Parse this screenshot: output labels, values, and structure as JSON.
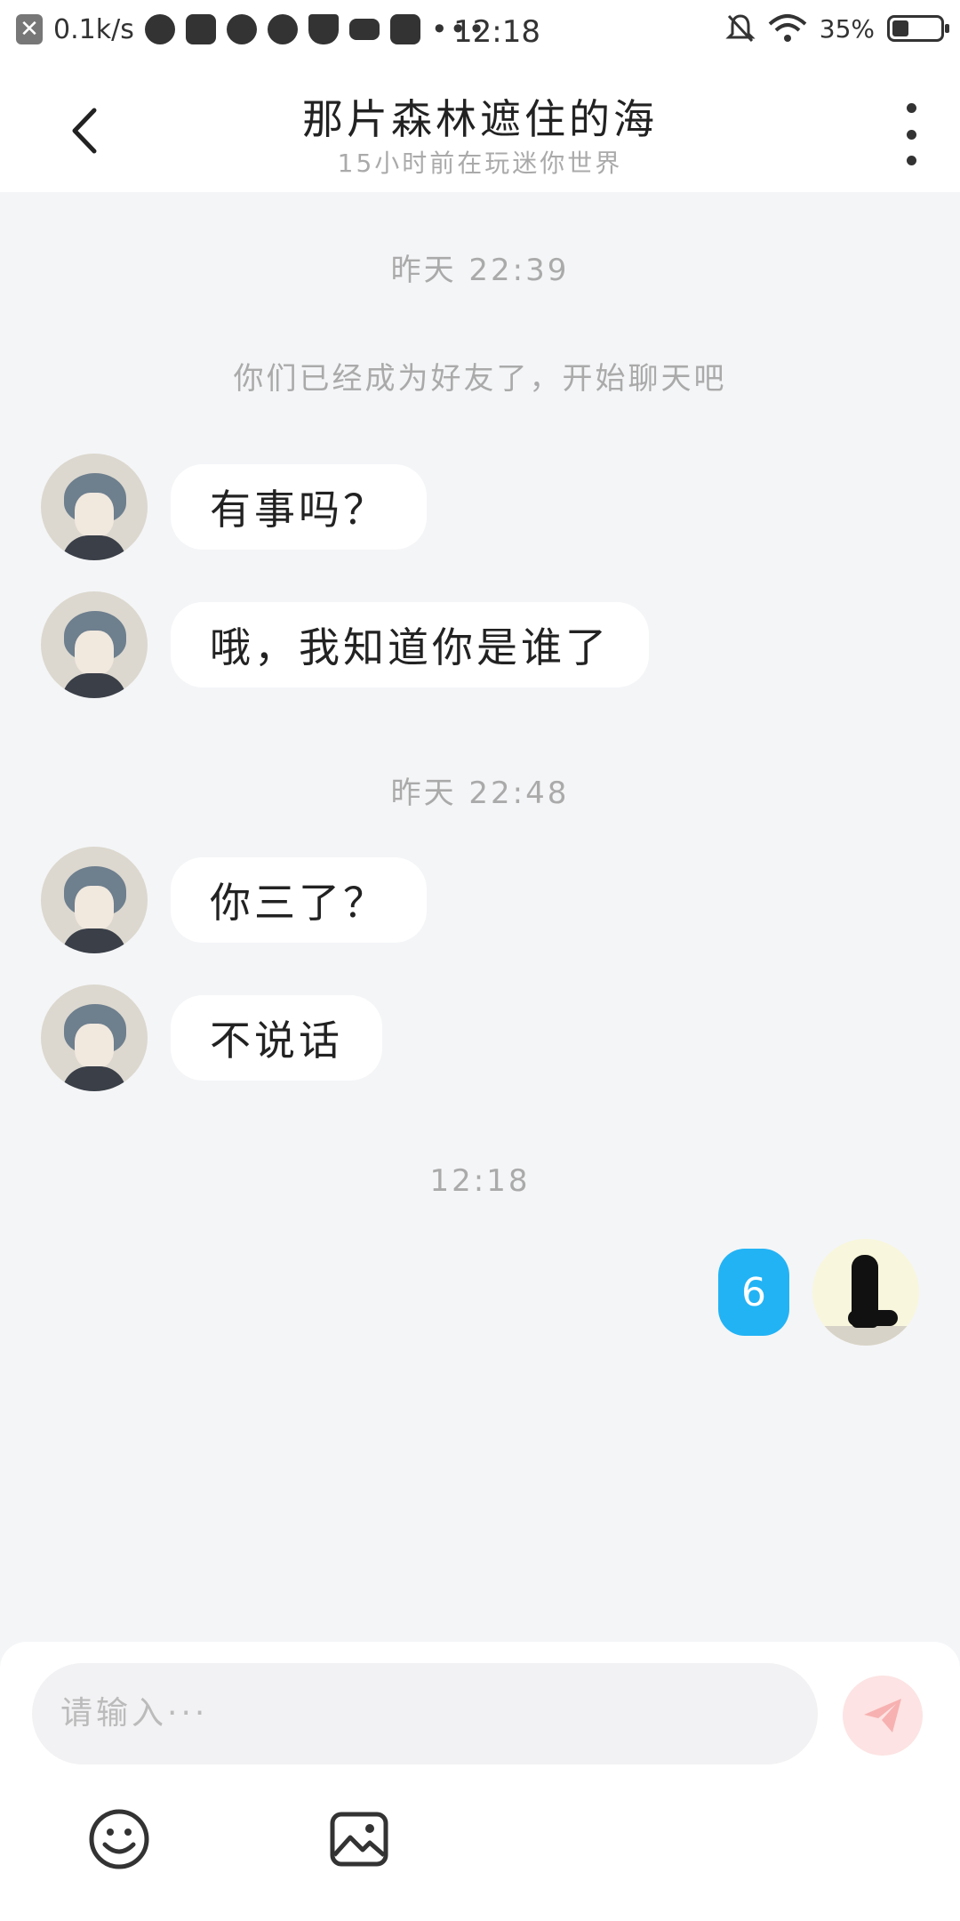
{
  "status_bar": {
    "speed": "0.1k/s",
    "time": "12:18",
    "battery": "35%",
    "battery_level": 0.35,
    "icons": [
      "close-icon",
      "weather-cloud-icon",
      "play-icon",
      "pinwheel-icon",
      "planet-icon",
      "shield-icon",
      "crown-icon",
      "app-icon",
      "more-dots-icon",
      "mute-bell-icon",
      "wifi-icon",
      "battery-icon"
    ]
  },
  "header": {
    "title": "那片森林遮住的海",
    "subtitle": "15小时前在玩迷你世界",
    "back_icon": "chevron-left-icon",
    "more_icon": "more-vertical-icon"
  },
  "chat": {
    "timestamps": [
      "昨天 22:39",
      "昨天 22:48",
      "12:18"
    ],
    "system_message": "你们已经成为好友了，开始聊天吧",
    "messages": [
      {
        "from": "friend",
        "text": "有事吗？"
      },
      {
        "from": "friend",
        "text": "哦，我知道你是谁了"
      },
      {
        "from": "friend",
        "text": "你三了？"
      },
      {
        "from": "friend",
        "text": "不说话"
      },
      {
        "from": "me",
        "text": "6"
      }
    ]
  },
  "input_bar": {
    "placeholder": "请输入···",
    "send_icon": "paper-plane-icon",
    "tools": [
      "emoji-icon",
      "image-icon"
    ]
  },
  "colors": {
    "my_bubble": "#22b3f5",
    "background": "#f4f5f7",
    "send_button": "#fde3e3"
  }
}
